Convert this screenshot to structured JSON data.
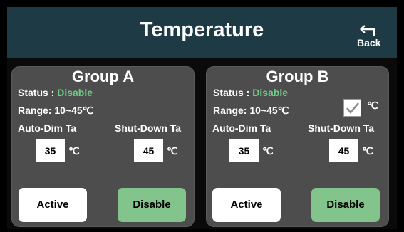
{
  "header": {
    "title": "Temperature",
    "back_label": "Back"
  },
  "groups": [
    {
      "title": "Group A",
      "status_label": "Status :",
      "status_value": "Disable",
      "range_label": "Range:",
      "range_value": "10~45℃",
      "auto_dim_label": "Auto-Dim Ta",
      "auto_dim_value": "35",
      "shutdown_label": "Shut-Down Ta",
      "shutdown_value": "45",
      "unit": "℃",
      "active_label": "Active",
      "disable_label": "Disable"
    },
    {
      "title": "Group B",
      "status_label": "Status :",
      "status_value": "Disable",
      "range_label": "Range:",
      "range_value": "10~45℃",
      "auto_dim_label": "Auto-Dim Ta",
      "auto_dim_value": "35",
      "shutdown_label": "Shut-Down Ta",
      "shutdown_value": "45",
      "unit": "℃",
      "checkbox_checked": true,
      "active_label": "Active",
      "disable_label": "Disable"
    }
  ],
  "colors": {
    "header_bg": "#1e3a44",
    "panel_bg": "#4c4d4c",
    "status_green": "#6dcf87",
    "disable_button": "#82c48b"
  }
}
